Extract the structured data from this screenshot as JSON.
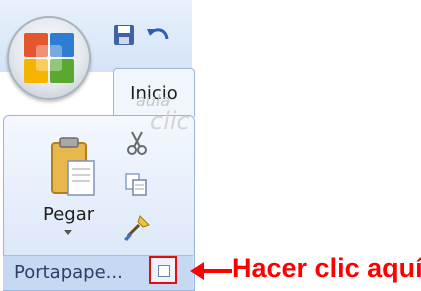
{
  "ribbon": {
    "tab_label": "Inicio",
    "group_label": "Portapape...",
    "paste_label": "Pegar"
  },
  "watermark": {
    "line1": "aula",
    "line2": "clic"
  },
  "annotation": {
    "text": "Hacer clic aquí"
  },
  "colors": {
    "callout": "#ff0000",
    "highlight_border": "#e01010",
    "ribbon_blue": "#c7d9f2"
  },
  "icons": [
    "office-logo-icon",
    "save-icon",
    "undo-icon",
    "paste-clipboard-icon",
    "cut-scissors-icon",
    "copy-icon",
    "format-painter-icon",
    "dialog-launcher-icon",
    "red-arrow-icon"
  ]
}
